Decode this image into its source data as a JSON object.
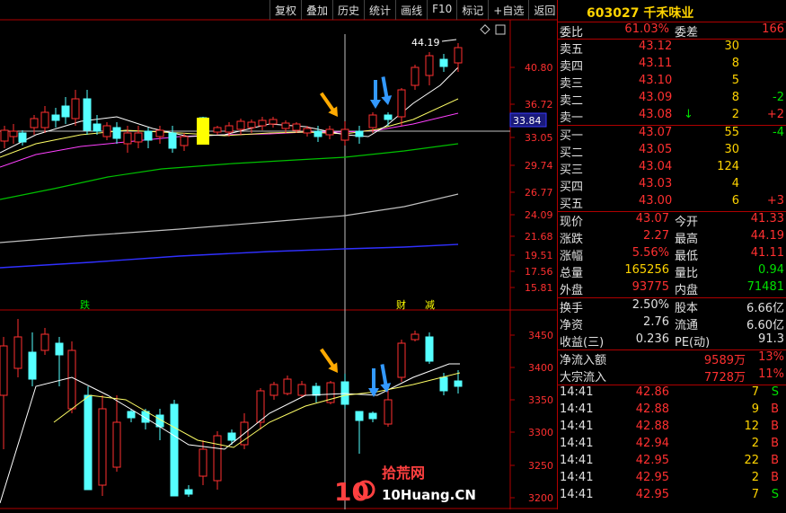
{
  "toolbar": [
    "复权",
    "叠加",
    "历史",
    "统计",
    "画线",
    "F10",
    "标记",
    "+自选",
    "返回"
  ],
  "header": {
    "code_name": "603027 千禾味业"
  },
  "chart": {
    "price_axis_labels": [
      "40.80",
      "36.72",
      "33.05",
      "29.74",
      "26.77",
      "24.09",
      "21.68",
      "19.51",
      "17.56",
      "15.81"
    ],
    "current_price_tag": "33.84",
    "high_annotation": "44.19",
    "event_markers": [
      "跌",
      "财",
      "减"
    ],
    "volume_axis_labels": [
      "3450",
      "3400",
      "3350",
      "3300",
      "3250",
      "3200"
    ],
    "watermark": {
      "digits": "10",
      "cn": "拾荒网",
      "en": "10Huang.CN"
    },
    "colors": {
      "up": "#ff3030",
      "down": "#55ffff",
      "ma5": "#ffffff",
      "ma10": "#ffff66",
      "ma20": "#ff40ff",
      "ma60": "#00c000",
      "ma120": "#c0c0c0",
      "ma250": "#3030ff",
      "arrow_orange": "#ffaa00",
      "arrow_blue": "#3399ff"
    }
  },
  "order_book": {
    "ratio": {
      "label": "委比",
      "value": "61.03%",
      "label2": "委差",
      "value2": "166"
    },
    "asks": [
      {
        "label": "卖五",
        "price": "43.12",
        "qty": "30",
        "chg": ""
      },
      {
        "label": "卖四",
        "price": "43.11",
        "qty": "8",
        "chg": ""
      },
      {
        "label": "卖三",
        "price": "43.10",
        "qty": "5",
        "chg": ""
      },
      {
        "label": "卖二",
        "price": "43.09",
        "qty": "8",
        "chg": "-2"
      },
      {
        "label": "卖一",
        "price": "43.08",
        "qty": "2",
        "chg": "+2",
        "arrow": "↓"
      }
    ],
    "bids": [
      {
        "label": "买一",
        "price": "43.07",
        "qty": "55",
        "chg": "-4"
      },
      {
        "label": "买二",
        "price": "43.05",
        "qty": "30",
        "chg": ""
      },
      {
        "label": "买三",
        "price": "43.04",
        "qty": "124",
        "chg": ""
      },
      {
        "label": "买四",
        "price": "43.03",
        "qty": "4",
        "chg": ""
      },
      {
        "label": "买五",
        "price": "43.00",
        "qty": "6",
        "chg": "+3"
      }
    ]
  },
  "quote": [
    {
      "l1": "现价",
      "v1": "43.07",
      "l2": "今开",
      "v2": "41.33",
      "c1": "red",
      "c2": "red"
    },
    {
      "l1": "涨跌",
      "v1": "2.27",
      "l2": "最高",
      "v2": "44.19",
      "c1": "red",
      "c2": "red"
    },
    {
      "l1": "涨幅",
      "v1": "5.56%",
      "l2": "最低",
      "v2": "41.11",
      "c1": "red",
      "c2": "red"
    },
    {
      "l1": "总量",
      "v1": "165256",
      "l2": "量比",
      "v2": "0.94",
      "c1": "yellow",
      "c2": "green"
    },
    {
      "l1": "外盘",
      "v1": "93775",
      "l2": "内盘",
      "v2": "71481",
      "c1": "red",
      "c2": "green"
    }
  ],
  "fundamentals": [
    {
      "l1": "换手",
      "v1": "2.50%",
      "l2": "股本",
      "v2": "6.66亿"
    },
    {
      "l1": "净资",
      "v1": "2.76",
      "l2": "流通",
      "v2": "6.60亿"
    },
    {
      "l1": "收益(三)",
      "v1": "0.236",
      "l2": "PE(动)",
      "v2": "91.3"
    }
  ],
  "flow": [
    {
      "label": "净流入额",
      "value": "9589万",
      "pct": "13%"
    },
    {
      "label": "大宗流入",
      "value": "7728万",
      "pct": "11%"
    }
  ],
  "ticks": [
    {
      "time": "14:41",
      "price": "42.86",
      "vol": "7",
      "bs": "S"
    },
    {
      "time": "14:41",
      "price": "42.88",
      "vol": "9",
      "bs": "B"
    },
    {
      "time": "14:41",
      "price": "42.88",
      "vol": "12",
      "bs": "B"
    },
    {
      "time": "14:41",
      "price": "42.94",
      "vol": "2",
      "bs": "B"
    },
    {
      "time": "14:41",
      "price": "42.95",
      "vol": "22",
      "bs": "B"
    },
    {
      "time": "14:41",
      "price": "42.95",
      "vol": "2",
      "bs": "B"
    },
    {
      "time": "14:41",
      "price": "42.95",
      "vol": "7",
      "bs": "S"
    }
  ]
}
